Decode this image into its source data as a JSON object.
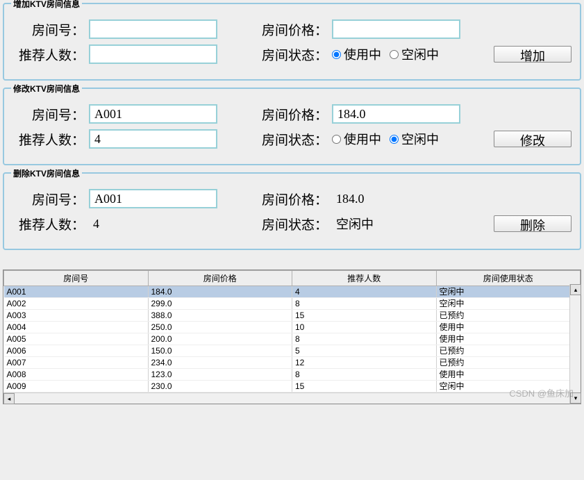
{
  "add": {
    "legend": "增加KTV房间信息",
    "room_no_label": "房间号：",
    "room_no_value": "",
    "price_label": "房间价格：",
    "price_value": "",
    "capacity_label": "推荐人数：",
    "capacity_value": "",
    "status_label": "房间状态：",
    "status_opt_in_use": "使用中",
    "status_opt_free": "空闲中",
    "btn": "增加"
  },
  "edit": {
    "legend": "修改KTV房间信息",
    "room_no_label": "房间号：",
    "room_no_value": "A001",
    "price_label": "房间价格：",
    "price_value": "184.0",
    "capacity_label": "推荐人数：",
    "capacity_value": "4",
    "status_label": "房间状态：",
    "status_opt_in_use": "使用中",
    "status_opt_free": "空闲中",
    "btn": "修改"
  },
  "del": {
    "legend": "删除KTV房间信息",
    "room_no_label": "房间号：",
    "room_no_value": "A001",
    "price_label": "房间价格：",
    "price_value": "184.0",
    "capacity_label": "推荐人数：",
    "capacity_value": "4",
    "status_label": "房间状态：",
    "status_value": "空闲中",
    "btn": "删除"
  },
  "table": {
    "headers": [
      "房间号",
      "房间价格",
      "推荐人数",
      "房间使用状态"
    ],
    "rows": [
      {
        "no": "A001",
        "price": "184.0",
        "cap": "4",
        "status": "空闲中",
        "sel": true
      },
      {
        "no": "A002",
        "price": "299.0",
        "cap": "8",
        "status": "空闲中"
      },
      {
        "no": "A003",
        "price": "388.0",
        "cap": "15",
        "status": "已预约"
      },
      {
        "no": "A004",
        "price": "250.0",
        "cap": "10",
        "status": "使用中"
      },
      {
        "no": "A005",
        "price": "200.0",
        "cap": "8",
        "status": "使用中"
      },
      {
        "no": "A006",
        "price": "150.0",
        "cap": "5",
        "status": "已预约"
      },
      {
        "no": "A007",
        "price": "234.0",
        "cap": "12",
        "status": "已预约"
      },
      {
        "no": "A008",
        "price": "123.0",
        "cap": "8",
        "status": "使用中"
      },
      {
        "no": "A009",
        "price": "230.0",
        "cap": "15",
        "status": "空闲中"
      }
    ]
  },
  "watermark": "CSDN @鱼床加"
}
